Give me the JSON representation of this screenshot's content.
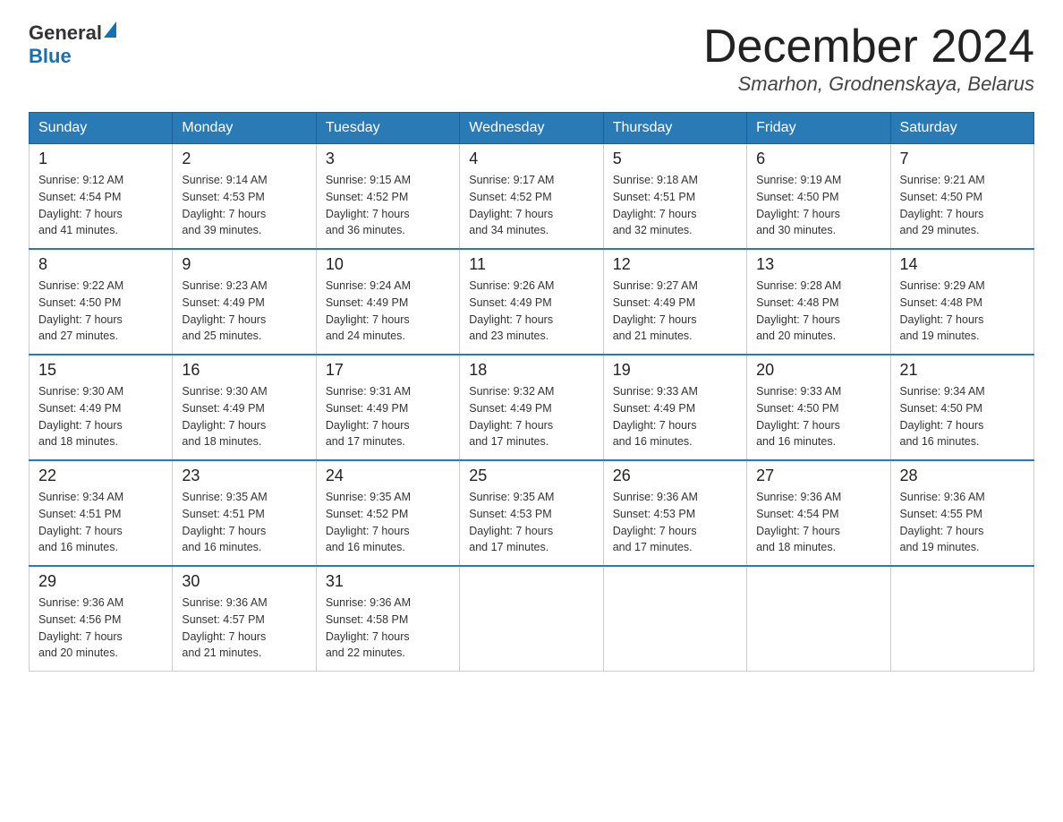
{
  "header": {
    "logo_general": "General",
    "logo_blue": "Blue",
    "month_title": "December 2024",
    "location": "Smarhon, Grodnenskaya, Belarus"
  },
  "weekdays": [
    "Sunday",
    "Monday",
    "Tuesday",
    "Wednesday",
    "Thursday",
    "Friday",
    "Saturday"
  ],
  "weeks": [
    [
      {
        "day": "1",
        "sunrise": "Sunrise: 9:12 AM",
        "sunset": "Sunset: 4:54 PM",
        "daylight": "Daylight: 7 hours",
        "daylight2": "and 41 minutes."
      },
      {
        "day": "2",
        "sunrise": "Sunrise: 9:14 AM",
        "sunset": "Sunset: 4:53 PM",
        "daylight": "Daylight: 7 hours",
        "daylight2": "and 39 minutes."
      },
      {
        "day": "3",
        "sunrise": "Sunrise: 9:15 AM",
        "sunset": "Sunset: 4:52 PM",
        "daylight": "Daylight: 7 hours",
        "daylight2": "and 36 minutes."
      },
      {
        "day": "4",
        "sunrise": "Sunrise: 9:17 AM",
        "sunset": "Sunset: 4:52 PM",
        "daylight": "Daylight: 7 hours",
        "daylight2": "and 34 minutes."
      },
      {
        "day": "5",
        "sunrise": "Sunrise: 9:18 AM",
        "sunset": "Sunset: 4:51 PM",
        "daylight": "Daylight: 7 hours",
        "daylight2": "and 32 minutes."
      },
      {
        "day": "6",
        "sunrise": "Sunrise: 9:19 AM",
        "sunset": "Sunset: 4:50 PM",
        "daylight": "Daylight: 7 hours",
        "daylight2": "and 30 minutes."
      },
      {
        "day": "7",
        "sunrise": "Sunrise: 9:21 AM",
        "sunset": "Sunset: 4:50 PM",
        "daylight": "Daylight: 7 hours",
        "daylight2": "and 29 minutes."
      }
    ],
    [
      {
        "day": "8",
        "sunrise": "Sunrise: 9:22 AM",
        "sunset": "Sunset: 4:50 PM",
        "daylight": "Daylight: 7 hours",
        "daylight2": "and 27 minutes."
      },
      {
        "day": "9",
        "sunrise": "Sunrise: 9:23 AM",
        "sunset": "Sunset: 4:49 PM",
        "daylight": "Daylight: 7 hours",
        "daylight2": "and 25 minutes."
      },
      {
        "day": "10",
        "sunrise": "Sunrise: 9:24 AM",
        "sunset": "Sunset: 4:49 PM",
        "daylight": "Daylight: 7 hours",
        "daylight2": "and 24 minutes."
      },
      {
        "day": "11",
        "sunrise": "Sunrise: 9:26 AM",
        "sunset": "Sunset: 4:49 PM",
        "daylight": "Daylight: 7 hours",
        "daylight2": "and 23 minutes."
      },
      {
        "day": "12",
        "sunrise": "Sunrise: 9:27 AM",
        "sunset": "Sunset: 4:49 PM",
        "daylight": "Daylight: 7 hours",
        "daylight2": "and 21 minutes."
      },
      {
        "day": "13",
        "sunrise": "Sunrise: 9:28 AM",
        "sunset": "Sunset: 4:48 PM",
        "daylight": "Daylight: 7 hours",
        "daylight2": "and 20 minutes."
      },
      {
        "day": "14",
        "sunrise": "Sunrise: 9:29 AM",
        "sunset": "Sunset: 4:48 PM",
        "daylight": "Daylight: 7 hours",
        "daylight2": "and 19 minutes."
      }
    ],
    [
      {
        "day": "15",
        "sunrise": "Sunrise: 9:30 AM",
        "sunset": "Sunset: 4:49 PM",
        "daylight": "Daylight: 7 hours",
        "daylight2": "and 18 minutes."
      },
      {
        "day": "16",
        "sunrise": "Sunrise: 9:30 AM",
        "sunset": "Sunset: 4:49 PM",
        "daylight": "Daylight: 7 hours",
        "daylight2": "and 18 minutes."
      },
      {
        "day": "17",
        "sunrise": "Sunrise: 9:31 AM",
        "sunset": "Sunset: 4:49 PM",
        "daylight": "Daylight: 7 hours",
        "daylight2": "and 17 minutes."
      },
      {
        "day": "18",
        "sunrise": "Sunrise: 9:32 AM",
        "sunset": "Sunset: 4:49 PM",
        "daylight": "Daylight: 7 hours",
        "daylight2": "and 17 minutes."
      },
      {
        "day": "19",
        "sunrise": "Sunrise: 9:33 AM",
        "sunset": "Sunset: 4:49 PM",
        "daylight": "Daylight: 7 hours",
        "daylight2": "and 16 minutes."
      },
      {
        "day": "20",
        "sunrise": "Sunrise: 9:33 AM",
        "sunset": "Sunset: 4:50 PM",
        "daylight": "Daylight: 7 hours",
        "daylight2": "and 16 minutes."
      },
      {
        "day": "21",
        "sunrise": "Sunrise: 9:34 AM",
        "sunset": "Sunset: 4:50 PM",
        "daylight": "Daylight: 7 hours",
        "daylight2": "and 16 minutes."
      }
    ],
    [
      {
        "day": "22",
        "sunrise": "Sunrise: 9:34 AM",
        "sunset": "Sunset: 4:51 PM",
        "daylight": "Daylight: 7 hours",
        "daylight2": "and 16 minutes."
      },
      {
        "day": "23",
        "sunrise": "Sunrise: 9:35 AM",
        "sunset": "Sunset: 4:51 PM",
        "daylight": "Daylight: 7 hours",
        "daylight2": "and 16 minutes."
      },
      {
        "day": "24",
        "sunrise": "Sunrise: 9:35 AM",
        "sunset": "Sunset: 4:52 PM",
        "daylight": "Daylight: 7 hours",
        "daylight2": "and 16 minutes."
      },
      {
        "day": "25",
        "sunrise": "Sunrise: 9:35 AM",
        "sunset": "Sunset: 4:53 PM",
        "daylight": "Daylight: 7 hours",
        "daylight2": "and 17 minutes."
      },
      {
        "day": "26",
        "sunrise": "Sunrise: 9:36 AM",
        "sunset": "Sunset: 4:53 PM",
        "daylight": "Daylight: 7 hours",
        "daylight2": "and 17 minutes."
      },
      {
        "day": "27",
        "sunrise": "Sunrise: 9:36 AM",
        "sunset": "Sunset: 4:54 PM",
        "daylight": "Daylight: 7 hours",
        "daylight2": "and 18 minutes."
      },
      {
        "day": "28",
        "sunrise": "Sunrise: 9:36 AM",
        "sunset": "Sunset: 4:55 PM",
        "daylight": "Daylight: 7 hours",
        "daylight2": "and 19 minutes."
      }
    ],
    [
      {
        "day": "29",
        "sunrise": "Sunrise: 9:36 AM",
        "sunset": "Sunset: 4:56 PM",
        "daylight": "Daylight: 7 hours",
        "daylight2": "and 20 minutes."
      },
      {
        "day": "30",
        "sunrise": "Sunrise: 9:36 AM",
        "sunset": "Sunset: 4:57 PM",
        "daylight": "Daylight: 7 hours",
        "daylight2": "and 21 minutes."
      },
      {
        "day": "31",
        "sunrise": "Sunrise: 9:36 AM",
        "sunset": "Sunset: 4:58 PM",
        "daylight": "Daylight: 7 hours",
        "daylight2": "and 22 minutes."
      },
      null,
      null,
      null,
      null
    ]
  ]
}
